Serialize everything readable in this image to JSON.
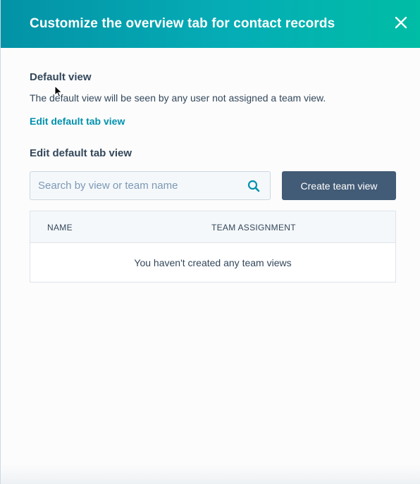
{
  "header": {
    "title": "Customize the overview tab for contact records",
    "close_icon": "close-icon"
  },
  "default_view": {
    "title": "Default view",
    "description": "The default view will be seen by any user not assigned a team view.",
    "edit_link": "Edit default tab view"
  },
  "edit_section": {
    "title": "Edit default tab view",
    "search_placeholder": "Search by view or team name",
    "search_icon": "search-icon",
    "create_button": "Create team view"
  },
  "table": {
    "columns": [
      "NAME",
      "TEAM ASSIGNMENT"
    ],
    "empty_message": "You haven't created any team views"
  },
  "colors": {
    "header_gradient_start": "#0392a6",
    "header_gradient_end": "#00bda5",
    "link": "#0091ae",
    "primary_button": "#425b76",
    "text": "#33475b"
  }
}
